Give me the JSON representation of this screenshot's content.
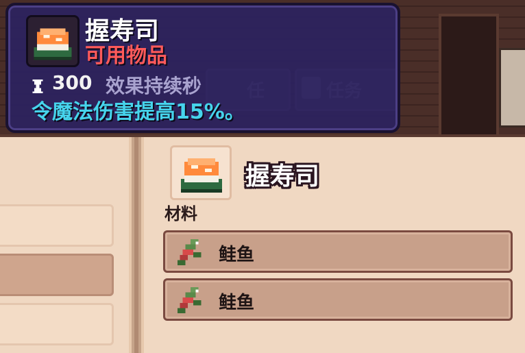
{
  "tooltip": {
    "title": "握寿司",
    "category": "可用物品",
    "duration_value": "300",
    "duration_label": "效果持续秒",
    "effect": "令魔法伤害提高15%。"
  },
  "background": {
    "tab_partial": "任",
    "tab_quest": "任务"
  },
  "recipe": {
    "name": "握寿司",
    "materials_label": "材料",
    "materials": [
      {
        "name": "鲑鱼",
        "icon": "salmon-icon"
      },
      {
        "name": "鲑鱼",
        "icon": "salmon-icon"
      }
    ]
  },
  "icons": {
    "item": "sushi-icon",
    "duration": "hourglass-icon",
    "quest_tab": "quill-icon"
  },
  "colors": {
    "tooltip_bg": "#2c2260",
    "title": "#ffffff",
    "category": "#ff5a5a",
    "effect": "#46d4ec",
    "panel_bg": "#f0d8c2",
    "material_row": "#c8a08a"
  }
}
